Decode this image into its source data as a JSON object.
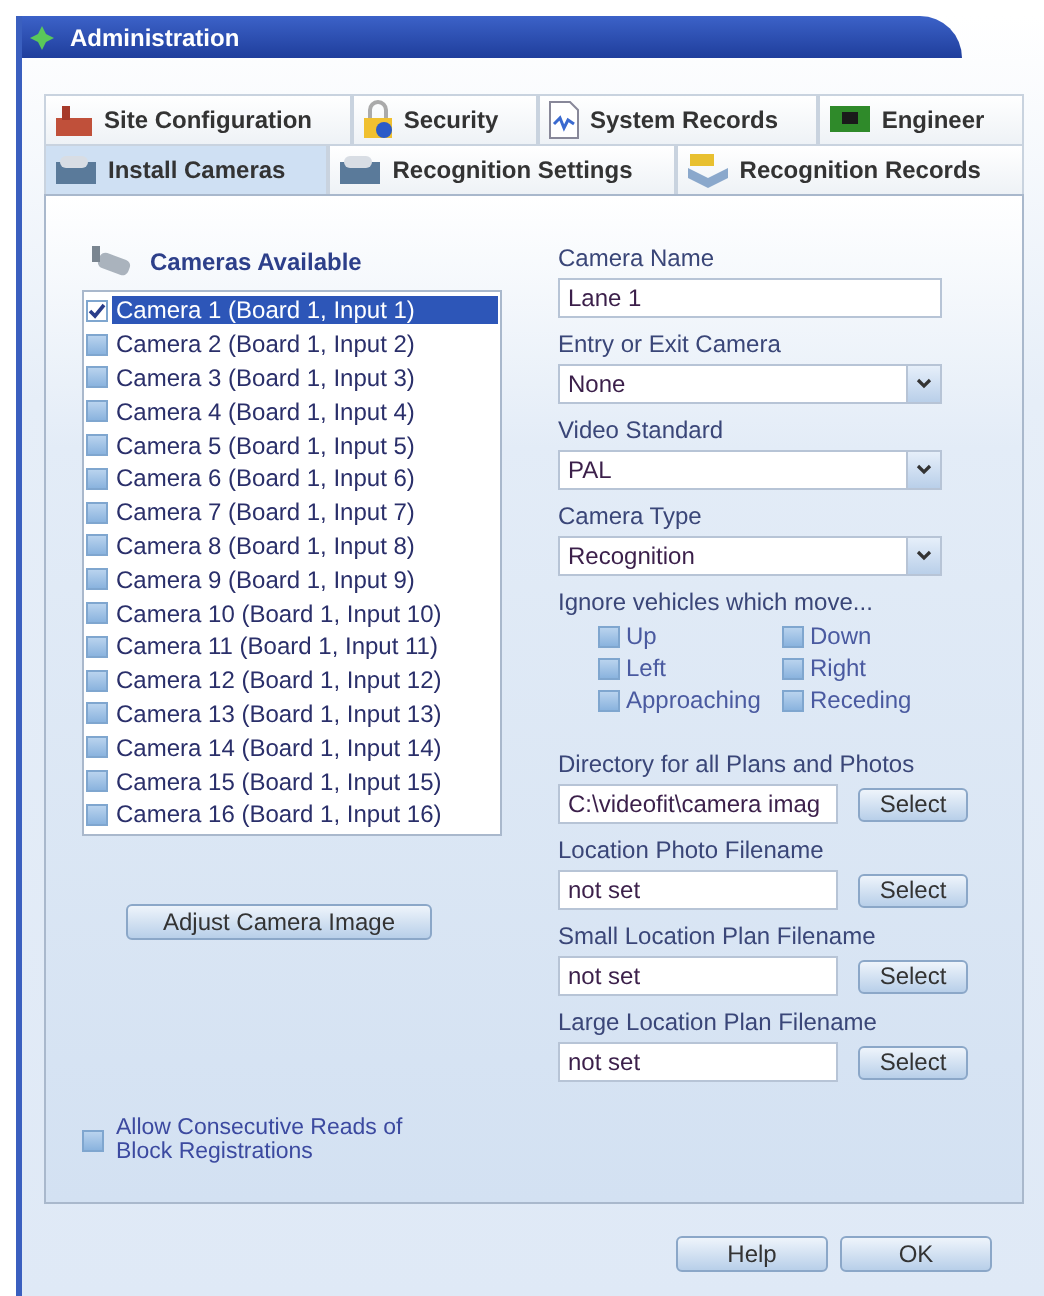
{
  "window": {
    "title": "Administration"
  },
  "tab_rows": [
    [
      {
        "label": "Site Configuration",
        "selected": false
      },
      {
        "label": "Security",
        "selected": false
      },
      {
        "label": "System Records",
        "selected": false
      },
      {
        "label": "Engineer",
        "selected": false
      }
    ],
    [
      {
        "label": "Install Cameras",
        "selected": true
      },
      {
        "label": "Recognition Settings",
        "selected": false
      },
      {
        "label": "Recognition Records",
        "selected": false
      }
    ]
  ],
  "cameras": {
    "title": "Cameras Available",
    "items": [
      {
        "label": "Camera 1 (Board 1, Input 1)",
        "checked": true,
        "selected": true
      },
      {
        "label": "Camera 2 (Board 1, Input 2)",
        "checked": false,
        "selected": false
      },
      {
        "label": "Camera 3 (Board 1, Input 3)",
        "checked": false,
        "selected": false
      },
      {
        "label": "Camera 4 (Board 1, Input 4)",
        "checked": false,
        "selected": false
      },
      {
        "label": "Camera 5 (Board 1, Input 5)",
        "checked": false,
        "selected": false
      },
      {
        "label": "Camera 6 (Board 1, Input 6)",
        "checked": false,
        "selected": false
      },
      {
        "label": "Camera 7 (Board 1, Input 7)",
        "checked": false,
        "selected": false
      },
      {
        "label": "Camera 8 (Board 1, Input 8)",
        "checked": false,
        "selected": false
      },
      {
        "label": "Camera 9 (Board 1, Input 9)",
        "checked": false,
        "selected": false
      },
      {
        "label": "Camera 10 (Board 1, Input 10)",
        "checked": false,
        "selected": false
      },
      {
        "label": "Camera 11 (Board 1, Input 11)",
        "checked": false,
        "selected": false
      },
      {
        "label": "Camera 12 (Board 1, Input 12)",
        "checked": false,
        "selected": false
      },
      {
        "label": "Camera 13 (Board 1, Input 13)",
        "checked": false,
        "selected": false
      },
      {
        "label": "Camera 14 (Board 1, Input 14)",
        "checked": false,
        "selected": false
      },
      {
        "label": "Camera 15 (Board 1, Input 15)",
        "checked": false,
        "selected": false
      },
      {
        "label": "Camera 16 (Board 1, Input 16)",
        "checked": false,
        "selected": false
      }
    ]
  },
  "adjust_button": "Adjust Camera Image",
  "allow_consecutive": {
    "label": "Allow Consecutive Reads of Block Registrations",
    "checked": false
  },
  "fields": [
    {
      "kind": "text",
      "label": "Camera Name",
      "value": "Lane 1"
    },
    {
      "kind": "select",
      "label": "Entry or Exit Camera",
      "value": "None"
    },
    {
      "kind": "select",
      "label": "Video Standard",
      "value": "PAL"
    },
    {
      "kind": "select",
      "label": "Camera Type",
      "value": "Recognition"
    }
  ],
  "ignore": {
    "label": "Ignore vehicles which move...",
    "options": [
      {
        "label": "Up",
        "checked": false
      },
      {
        "label": "Down",
        "checked": false
      },
      {
        "label": "Left",
        "checked": false
      },
      {
        "label": "Right",
        "checked": false
      },
      {
        "label": "Approaching",
        "checked": false
      },
      {
        "label": "Receding",
        "checked": false
      }
    ]
  },
  "file_fields": [
    {
      "label": "Directory for all Plans and Photos",
      "value": "C:\\videofit\\camera imag",
      "button": "Select"
    },
    {
      "label": "Location Photo Filename",
      "value": "not set",
      "button": "Select"
    },
    {
      "label": "Small Location Plan Filename",
      "value": "not set",
      "button": "Select"
    },
    {
      "label": "Large Location Plan Filename",
      "value": "not set",
      "button": "Select"
    }
  ],
  "buttons": [
    "Help",
    "OK"
  ]
}
